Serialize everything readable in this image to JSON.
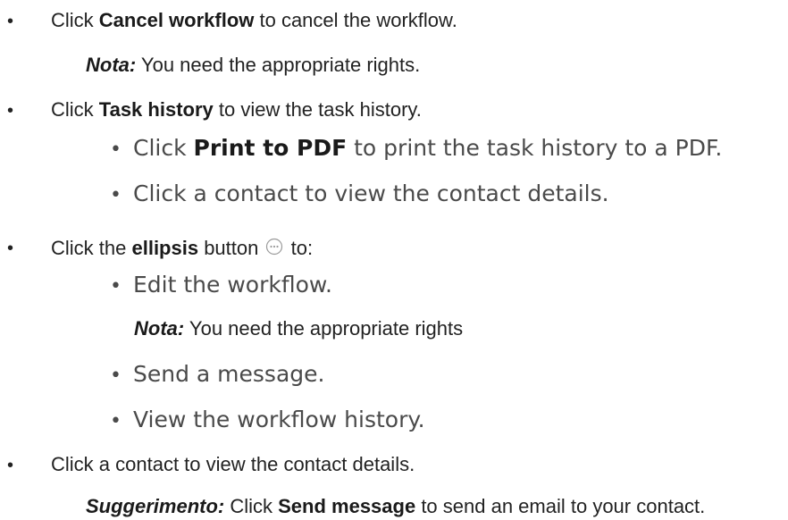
{
  "items": [
    {
      "bullet": "•",
      "pre": "Click ",
      "bold": "Cancel workflow",
      "post": " to cancel the workflow.",
      "note": {
        "label": "Nota:",
        "text": " You need the appropriate rights."
      }
    },
    {
      "bullet": "•",
      "pre": "Click ",
      "bold": "Task history",
      "post": " to view the task history.",
      "subitems": [
        {
          "bullet": "•",
          "pre": "Click ",
          "bold": "Print to PDF",
          "post": " to print the task history to a PDF."
        },
        {
          "bullet": "•",
          "text": "Click a contact to view the contact details."
        }
      ]
    },
    {
      "bullet": "•",
      "pre": "Click the ",
      "bold": "ellipsis",
      "mid": " button",
      "icon": "ellipsis-circle-icon",
      "post": " to:",
      "subitems": [
        {
          "bullet": "•",
          "text": "Edit the workflow."
        },
        {
          "bullet": "•",
          "text": "Send a message."
        },
        {
          "bullet": "•",
          "text": "View the workflow history."
        }
      ],
      "note": {
        "label": "Nota:",
        "text": " You need the appropriate rights"
      }
    },
    {
      "bullet": "•",
      "text": "Click a contact to view the contact details.",
      "tip": {
        "label": "Suggerimento:",
        "pre": " Click ",
        "bold": "Send message",
        "post": " to send an email to your contact."
      }
    }
  ],
  "colors": {
    "text": "#222222",
    "subtext": "#4a4a4a",
    "icon_stroke": "#9a9a9a"
  }
}
